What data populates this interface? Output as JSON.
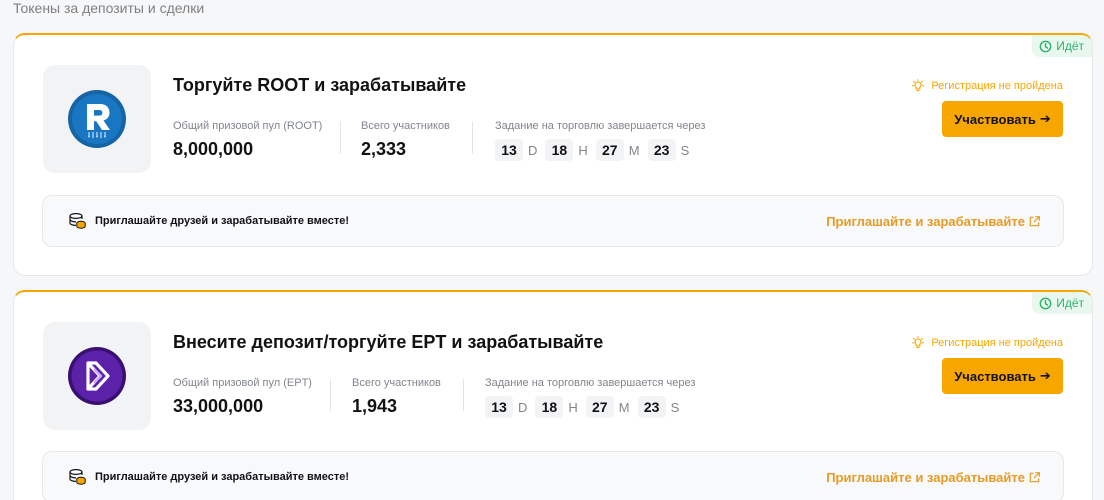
{
  "section_title": "Токены за депозиты и сделки",
  "colors": {
    "accent": "#f7a600",
    "status_green": "#2bb36b",
    "link_orange": "#e59b25"
  },
  "cards": [
    {
      "status": "Идёт",
      "logo_icon": "root-token-logo",
      "title": "Торгуйте ROOT и зарабатывайте",
      "pool_label": "Общий призовой пул (ROOT)",
      "pool_value": "8,000,000",
      "participants_label": "Всего участников",
      "participants_value": "2,333",
      "timer_label": "Задание на торговлю завершается через",
      "timer": {
        "d": "13",
        "d_unit": "D",
        "h": "18",
        "h_unit": "H",
        "m": "27",
        "m_unit": "M",
        "s": "23",
        "s_unit": "S"
      },
      "registration_status": "Регистрация не пройдена",
      "cta_label": "Участвовать",
      "cta_arrow": "➔",
      "invite_text": "Приглашайте друзей и зарабатывайте вместе!",
      "invite_link": "Приглашайте и зарабатывайте"
    },
    {
      "status": "Идёт",
      "logo_icon": "ept-token-logo",
      "title": "Внесите депозит/торгуйте EPT и зарабатывайте",
      "pool_label": "Общий призовой пул (EPT)",
      "pool_value": "33,000,000",
      "participants_label": "Всего участников",
      "participants_value": "1,943",
      "timer_label": "Задание на торговлю завершается через",
      "timer": {
        "d": "13",
        "d_unit": "D",
        "h": "18",
        "h_unit": "H",
        "m": "27",
        "m_unit": "M",
        "s": "23",
        "s_unit": "S"
      },
      "registration_status": "Регистрация не пройдена",
      "cta_label": "Участвовать",
      "cta_arrow": "➔",
      "invite_text": "Приглашайте друзей и зарабатывайте вместе!",
      "invite_link": "Приглашайте и зарабатывайте"
    }
  ]
}
